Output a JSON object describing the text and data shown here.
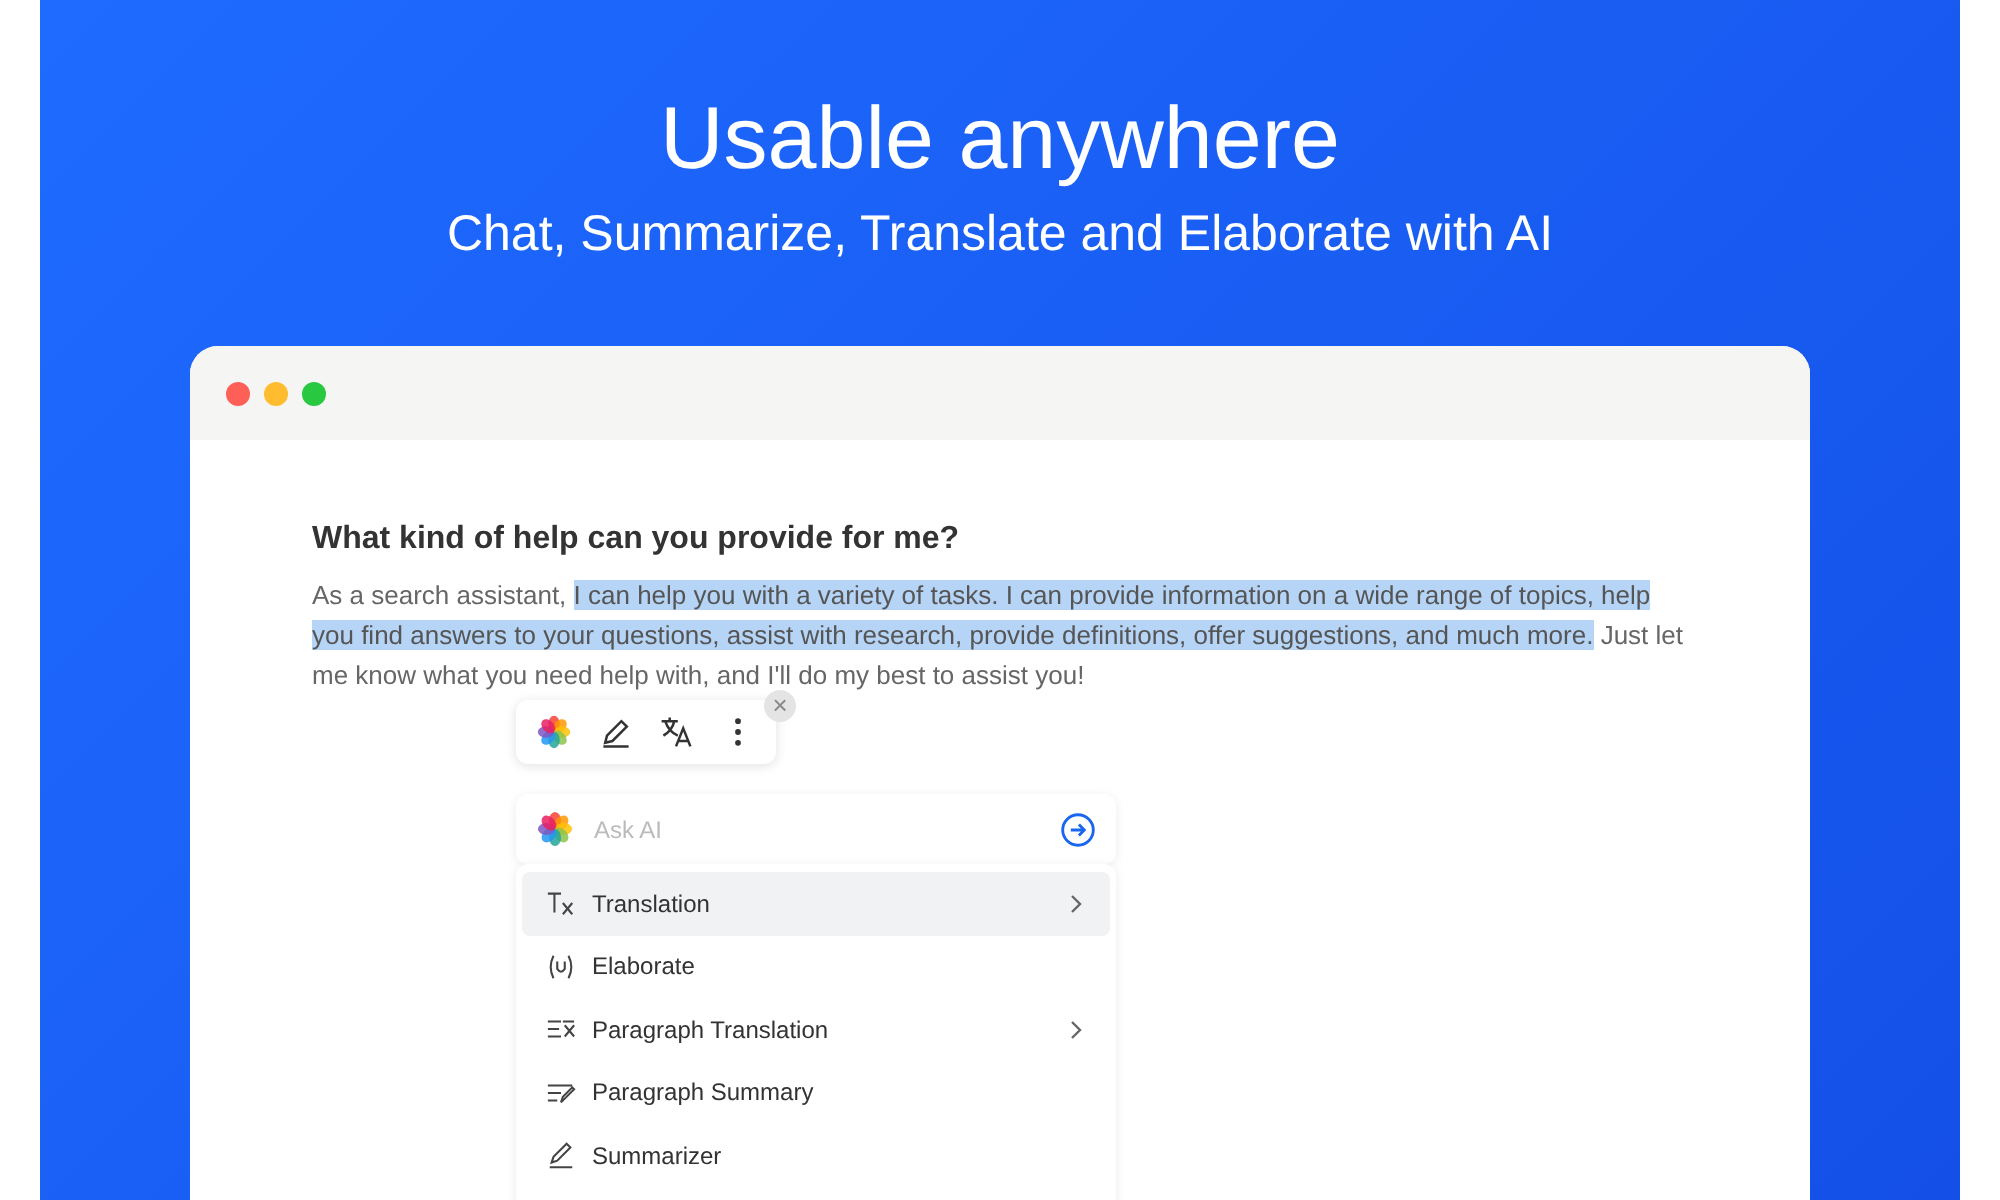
{
  "hero": {
    "title": "Usable anywhere",
    "subtitle": "Chat, Summarize, Translate and Elaborate with AI"
  },
  "window": {
    "dots": [
      {
        "color": "#fe5f57"
      },
      {
        "color": "#febc2e"
      },
      {
        "color": "#28c840"
      }
    ]
  },
  "question": "What kind of help can you provide for me?",
  "answer": [
    {
      "text": "As a search assistant, ",
      "selected": false
    },
    {
      "text": "I can help you with a variety of tasks. I can provide information on a wide range of topics, help you find answers to your questions, assist with research, provide definitions, offer suggestions, and much more.",
      "selected": true
    },
    {
      "text": " Just let me know what you need help with, and I'll do my best to assist you!",
      "selected": false
    }
  ],
  "toolbar": {
    "close": "×",
    "buttons": [
      {
        "kind": "logo"
      },
      {
        "kind": "pen"
      },
      {
        "kind": "translate"
      },
      {
        "kind": "more"
      }
    ]
  },
  "ask": {
    "placeholder": "Ask AI"
  },
  "menu": [
    {
      "label": "Translation",
      "kind": "translate",
      "submenu": true,
      "selected": true
    },
    {
      "label": "Elaborate",
      "kind": "elaborate",
      "submenu": false,
      "selected": false
    },
    {
      "label": "Paragraph Translation",
      "kind": "para-translate",
      "submenu": true,
      "selected": false
    },
    {
      "label": "Paragraph Summary",
      "kind": "para-summary",
      "submenu": false,
      "selected": false
    },
    {
      "label": "Summarizer",
      "kind": "pen",
      "submenu": false,
      "selected": false
    }
  ]
}
